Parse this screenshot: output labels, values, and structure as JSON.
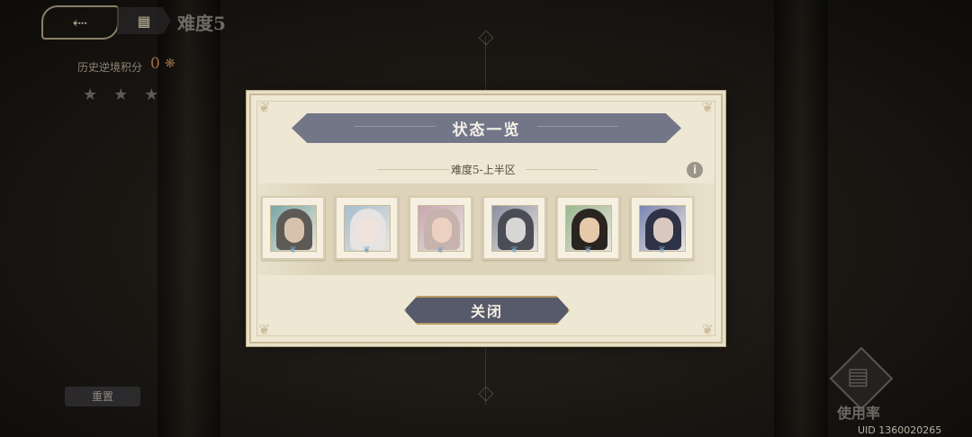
{
  "hud": {
    "back_icon": "back-arrow-icon",
    "menu_icon": "grid-icon",
    "stage_title": "难度5",
    "history_label": "历史逆境积分",
    "history_value": "0",
    "stars_earned": 0,
    "stars_total": 3,
    "reset_label": "重置",
    "usage_label": "使用率",
    "uid": "UID 1360020265"
  },
  "modal": {
    "title": "状态一览",
    "section_label": "难度5-上半区",
    "info_icon": "i",
    "close_label": "关闭",
    "portraits": [
      {
        "name": "portrait-1",
        "hair": "#5d5a55",
        "skin": "#d7c3ad",
        "bg": "#7aa7a4"
      },
      {
        "name": "portrait-2",
        "hair": "#e6e3e2",
        "skin": "#f0e3dc",
        "bg": "#a4bfcf"
      },
      {
        "name": "portrait-3",
        "hair": "#c7b3ae",
        "skin": "#ecd1c2",
        "bg": "#c7a7b0"
      },
      {
        "name": "portrait-4",
        "hair": "#4a4d55",
        "skin": "#d8d6d4",
        "bg": "#8a8fa0"
      },
      {
        "name": "portrait-5",
        "hair": "#2a2420",
        "skin": "#e6c9a9",
        "bg": "#9ab78f"
      },
      {
        "name": "portrait-6",
        "hair": "#2e3246",
        "skin": "#d9c8c0",
        "bg": "#7b86b2"
      }
    ]
  }
}
